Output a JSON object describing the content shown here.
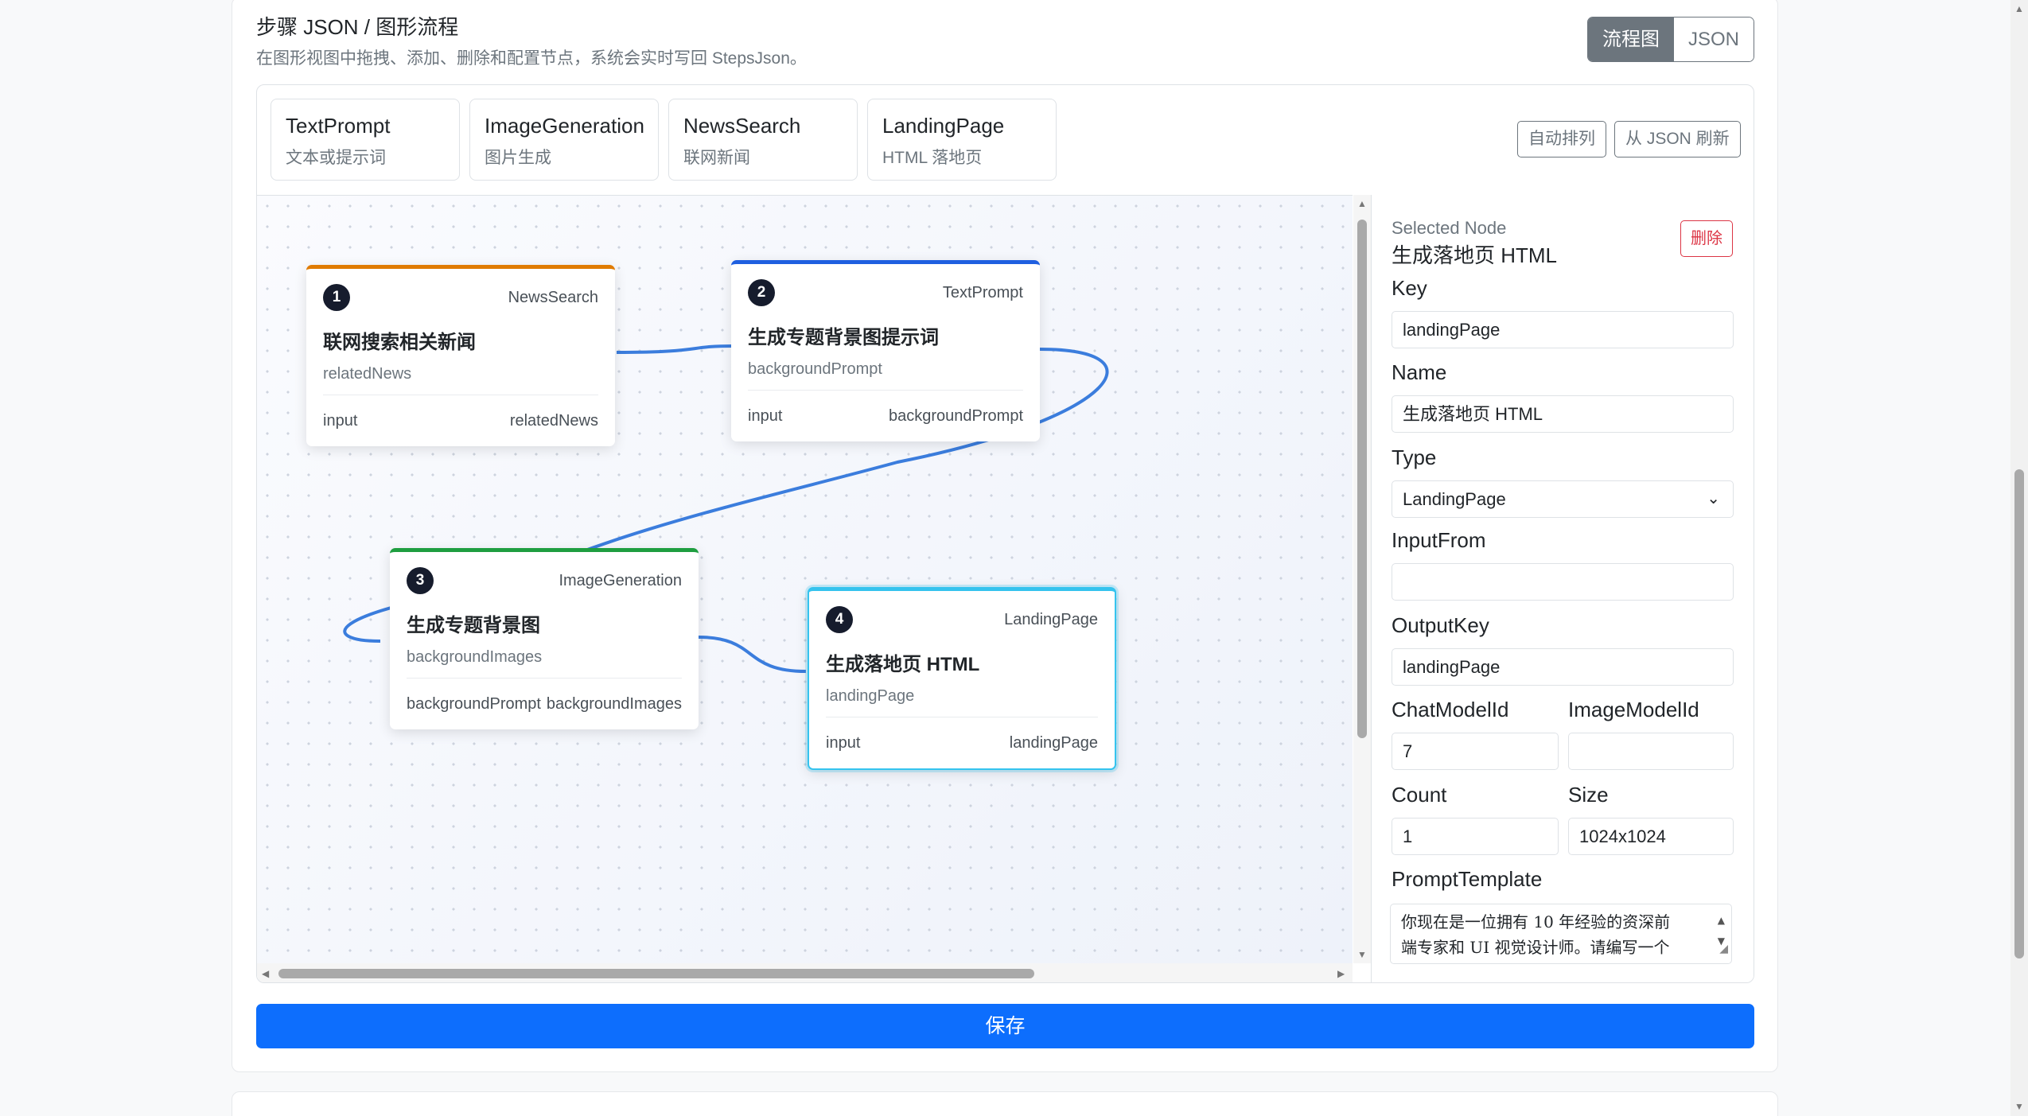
{
  "header": {
    "title": "步骤 JSON / 图形流程",
    "subtitle": "在图形视图中拖拽、添加、删除和配置节点，系统会实时写回 StepsJson。"
  },
  "view_toggle": {
    "flow_label": "流程图",
    "json_label": "JSON",
    "active": "flow"
  },
  "palette": [
    {
      "type": "TextPrompt",
      "desc": "文本或提示词"
    },
    {
      "type": "ImageGeneration",
      "desc": "图片生成"
    },
    {
      "type": "NewsSearch",
      "desc": "联网新闻"
    },
    {
      "type": "LandingPage",
      "desc": "HTML 落地页"
    }
  ],
  "toolbar": {
    "auto_layout_label": "自动排列",
    "refresh_label": "从 JSON 刷新"
  },
  "nodes": [
    {
      "index": "1",
      "type": "NewsSearch",
      "title": "联网搜索相关新闻",
      "output": "relatedNews",
      "port_in": "input",
      "port_out": "relatedNews",
      "accent": "#e07b00"
    },
    {
      "index": "2",
      "type": "TextPrompt",
      "title": "生成专题背景图提示词",
      "output": "backgroundPrompt",
      "port_in": "input",
      "port_out": "backgroundPrompt",
      "accent": "#1f5fe0"
    },
    {
      "index": "3",
      "type": "ImageGeneration",
      "title": "生成专题背景图",
      "output": "backgroundImages",
      "port_in": "backgroundPrompt",
      "port_out": "backgroundImages",
      "accent": "#1e9e40"
    },
    {
      "index": "4",
      "type": "LandingPage",
      "title": "生成落地页 HTML",
      "output": "landingPage",
      "port_in": "input",
      "port_out": "landingPage",
      "accent": "#35c3ee"
    }
  ],
  "panel": {
    "selected_label": "Selected Node",
    "selected_name": "生成落地页 HTML",
    "delete_label": "删除",
    "key_label": "Key",
    "key_value": "landingPage",
    "name_label": "Name",
    "name_value": "生成落地页 HTML",
    "type_label": "Type",
    "type_value": "LandingPage",
    "inputfrom_label": "InputFrom",
    "inputfrom_value": "",
    "outputkey_label": "OutputKey",
    "outputkey_value": "landingPage",
    "chatmodel_label": "ChatModelId",
    "chatmodel_value": "7",
    "imagemodel_label": "ImageModelId",
    "imagemodel_value": "",
    "count_label": "Count",
    "count_value": "1",
    "size_label": "Size",
    "size_value": "1024x1024",
    "prompt_label": "PromptTemplate",
    "prompt_line1": "你现在是一位拥有 10 年经验的资深前",
    "prompt_line2": "端专家和 UI 视觉设计师。请编写一个"
  },
  "save_label": "保存",
  "colors": {
    "primary": "#0d6efd",
    "danger": "#dc3545",
    "edge": "#3b7ddd",
    "secondary": "#6c757d"
  }
}
